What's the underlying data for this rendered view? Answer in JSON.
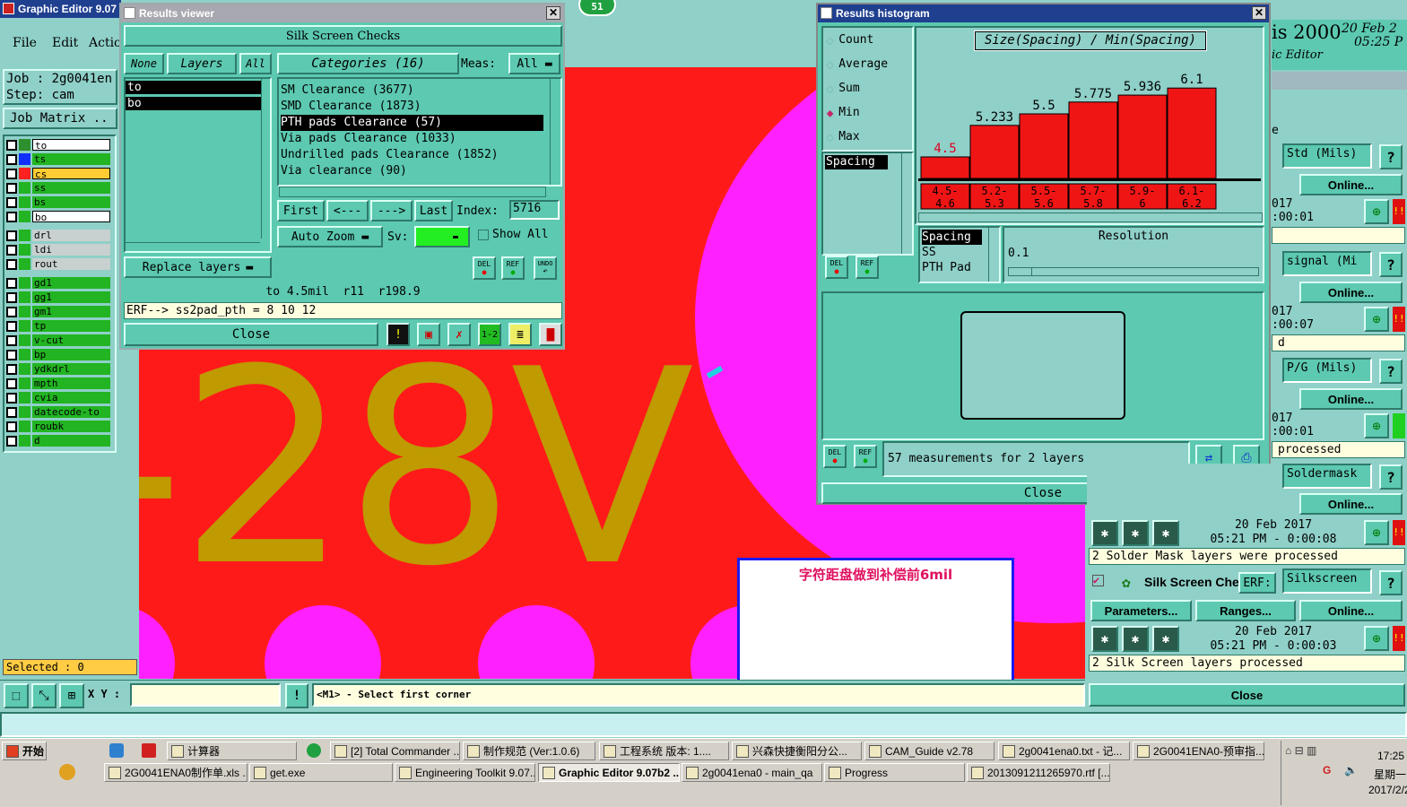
{
  "main_window": {
    "title": "Graphic Editor 9.07",
    "menu": [
      "File",
      "Edit",
      "Actio"
    ],
    "job_label": "Job : 2g0041en",
    "step_label": "Step: cam",
    "job_matrix": "Job Matrix ..",
    "selected": "Selected : 0",
    "xy_label": "X Y :",
    "status_msg": "<M1> - Select first corner"
  },
  "layers": [
    {
      "name": "to",
      "color": "#ffffff",
      "swatch": "#2d8f2d"
    },
    {
      "name": "ts",
      "color": "#22b422",
      "swatch": "#1030ff"
    },
    {
      "name": "cs",
      "color": "#ffcc33",
      "swatch": "#ff2020"
    },
    {
      "name": "ss",
      "color": "#22b422",
      "swatch": "#22b422"
    },
    {
      "name": "bs",
      "color": "#22b422",
      "swatch": "#22b422"
    },
    {
      "name": "bo",
      "color": "#ffffff",
      "swatch": "#22b422"
    },
    {
      "name": "drl",
      "color": "#c8d0d0",
      "swatch": "#22b422"
    },
    {
      "name": "ldi",
      "color": "#c8d0d0",
      "swatch": "#22b422"
    },
    {
      "name": "rout",
      "color": "#c8d0d0",
      "swatch": "#22b422"
    },
    {
      "name": "gd1",
      "color": "#22b422",
      "swatch": "#22b422"
    },
    {
      "name": "gg1",
      "color": "#22b422",
      "swatch": "#22b422"
    },
    {
      "name": "gm1",
      "color": "#22b422",
      "swatch": "#22b422"
    },
    {
      "name": "tp",
      "color": "#22b422",
      "swatch": "#22b422"
    },
    {
      "name": "v-cut",
      "color": "#22b422",
      "swatch": "#22b422"
    },
    {
      "name": "bp",
      "color": "#22b422",
      "swatch": "#22b422"
    },
    {
      "name": "ydkdrl",
      "color": "#22b422",
      "swatch": "#22b422"
    },
    {
      "name": "mpth",
      "color": "#22b422",
      "swatch": "#22b422"
    },
    {
      "name": "cvia",
      "color": "#22b422",
      "swatch": "#22b422"
    },
    {
      "name": "datecode-to",
      "color": "#22b422",
      "swatch": "#22b422"
    },
    {
      "name": "roubk",
      "color": "#22b422",
      "swatch": "#22b422"
    },
    {
      "name": "d",
      "color": "#22b422",
      "swatch": "#22b422"
    }
  ],
  "canvas": {
    "text": "-28V",
    "note": "字符距盘做到补偿前6mil"
  },
  "results_viewer": {
    "title": "Results viewer",
    "heading": "Silk Screen Checks",
    "btn_none": "None",
    "btn_layers": "Layers",
    "btn_all": "All",
    "categories_btn": "Categories (16)",
    "meas_label": "Meas:",
    "meas_value": "All",
    "layer_items": [
      "to",
      "bo"
    ],
    "categories": [
      "SM Clearance (3677)",
      "SMD Clearance (1873)",
      "PTH pads Clearance (57)",
      "Via pads Clearance (1033)",
      "Undrilled pads Clearance (1852)",
      "Via clearance (90)"
    ],
    "nav": {
      "first": "First",
      "prev": "<---",
      "next": "--->",
      "last": "Last",
      "index_label": "Index:",
      "index_value": "5716"
    },
    "auto_zoom": "Auto Zoom",
    "sv_label": "Sv:",
    "show_all": "Show All",
    "replace_layers": "Replace layers",
    "del": "DEL",
    "ref": "REF",
    "undo": "UNDO",
    "info": "to 4.5mil  r11  r198.9",
    "erf": "ERF--> ss2pad_pth = 8 10 12",
    "close": "Close"
  },
  "histogram": {
    "title": "Results histogram",
    "modes": [
      "Count",
      "Average",
      "Sum",
      "Min",
      "Max"
    ],
    "selected_mode": "Min",
    "heading": "Size(Spacing) / Min(Spacing)",
    "meas_list": [
      "Spacing"
    ],
    "meas_list2": [
      "Spacing",
      "SS",
      "PTH Pad"
    ],
    "resolution_label": "Resolution",
    "resolution_value": "0.1",
    "status": "57 measurements for 2 layers",
    "close": "Close",
    "del": "DEL",
    "ref": "REF"
  },
  "chart_data": {
    "type": "bar",
    "title": "Size(Spacing) / Min(Spacing)",
    "categories": [
      "4.5-4.6",
      "5.2-5.3",
      "5.5-5.6",
      "5.7-5.8",
      "5.9-6",
      "6.1-6.2"
    ],
    "category_labels": [
      [
        "4.5-",
        "4.6"
      ],
      [
        "5.2-",
        "5.3"
      ],
      [
        "5.5-",
        "5.6"
      ],
      [
        "5.7-",
        "5.8"
      ],
      [
        "5.9-",
        "6"
      ],
      [
        "6.1-",
        "6.2"
      ]
    ],
    "values": [
      4.5,
      5.233,
      5.5,
      5.775,
      5.936,
      6.1
    ],
    "value_labels": [
      "4.5",
      "5.233",
      "5.5",
      "5.775",
      "5.936",
      "6.1"
    ],
    "ylim": [
      0,
      6.5
    ]
  },
  "right_panel": {
    "title_big": "is 2000",
    "date1": "20 Feb 2",
    "time1": "05:25 P",
    "subtitle": "ic Editor",
    "rows": [
      {
        "field": "Std (Mils)",
        "online": "Online...",
        "ts": "017",
        "ts2": ":00:01",
        "msg": ""
      },
      {
        "field": "signal (Mi",
        "online": "Online...",
        "ts": "017",
        "ts2": ":00:07",
        "msg": "d"
      },
      {
        "field": "P/G (Mils)",
        "online": "Online...",
        "ts": "017",
        "ts2": ":00:01",
        "msg": "processed"
      }
    ],
    "soldermask_field": "Soldermask",
    "online4": "Online...",
    "sm_date": "20 Feb 2017",
    "sm_time": "05:21 PM - 0:00:08",
    "sm_msg": "2 Solder Mask layers were processed",
    "silk_title": "Silk Screen Che",
    "erf_label": "ERF:",
    "silk_field": "Silkscreen",
    "parameters": "Parameters...",
    "ranges": "Ranges...",
    "online5": "Online...",
    "ss_date": "20 Feb 2017",
    "ss_time": "05:21 PM - 0:00:03",
    "ss_msg": "2 Silk Screen layers processed",
    "close": "Close",
    "e": "e"
  },
  "badge": "51",
  "taskbar": {
    "start": "开始",
    "row1": [
      "计算器",
      "[2] Total Commander ...",
      "制作规范 (Ver:1.0.6)",
      "工程系统  版本: 1....",
      "兴森快捷衡阳分公...",
      "CAM_Guide v2.78",
      "2g0041ena0.txt - 记...",
      "2G0041ENA0-预审指..."
    ],
    "row2": [
      "2G0041ENA0制作单.xls ...",
      "get.exe",
      "Engineering Toolkit 9.07...",
      "Graphic Editor 9.07b2 ...",
      "2g0041ena0 - main_qa",
      "Progress",
      "2013091211265970.rtf [..."
    ],
    "clock": "17:25",
    "weekday": "星期一",
    "date": "2017/2/2"
  }
}
